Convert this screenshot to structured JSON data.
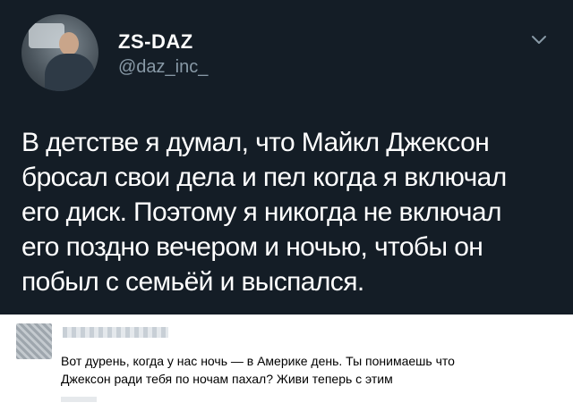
{
  "tweet": {
    "display_name": "ZS-DAZ",
    "handle": "@daz_inc_",
    "text_lines": [
      "В детстве я думал, что Майкл Джексон",
      "бросал свои дела и пел когда я включал",
      "его диск. Поэтому я никогда не включал",
      "его поздно вечером и ночью, чтобы он",
      "побыл с семьёй и выспался."
    ],
    "icons": {
      "avatar": "profile-photo",
      "menu": "chevron-down-icon"
    },
    "colors": {
      "background": "#141d26",
      "name": "#ffffff",
      "handle": "#8899a6",
      "text": "#ffffff"
    }
  },
  "comment": {
    "text_lines": [
      "Вот дурень, когда у нас ночь — в Америке день. Ты понимаешь что",
      "Джексон ради тебя по ночам пахал? Живи теперь с этим"
    ],
    "colors": {
      "background": "#ffffff",
      "text": "#000000"
    }
  }
}
